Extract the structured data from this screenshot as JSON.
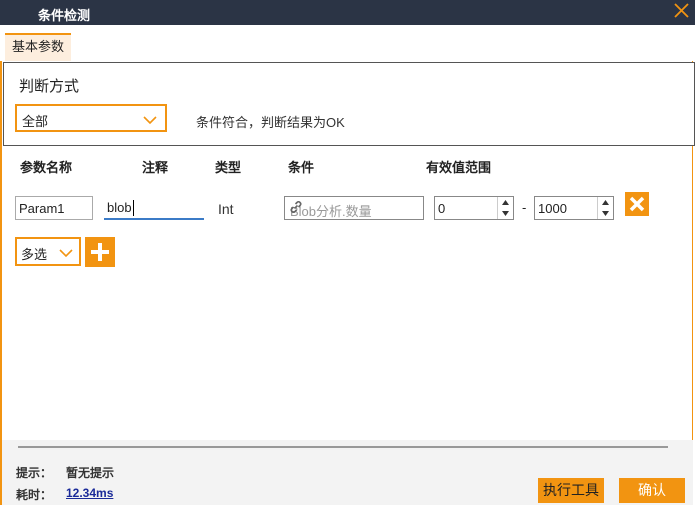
{
  "window": {
    "title": "条件检测"
  },
  "tabs": [
    {
      "label": "基本参数"
    }
  ],
  "judge": {
    "title": "判断方式",
    "mode_value": "全部",
    "description": "条件符合，判断结果为OK"
  },
  "table": {
    "headers": {
      "name": "参数名称",
      "remark": "注释",
      "type": "类型",
      "condition": "条件",
      "range": "有效值范围"
    },
    "rows": [
      {
        "name": "Param1",
        "remark": "blob",
        "type": "Int",
        "condition_placeholder": "Blob分析.数量",
        "min": "0",
        "range_sep": "-",
        "max": "1000"
      }
    ]
  },
  "add_mode": {
    "value": "多选"
  },
  "footer": {
    "tip_label": "提示：",
    "tip_value": "暂无提示",
    "time_label": "耗时：",
    "time_value": "12.34ms",
    "exec_label": "执行工具",
    "ok_label": "确认"
  },
  "colors": {
    "accent": "#f29411",
    "titlebar": "#2b3445",
    "focus": "#3b7bc7"
  }
}
